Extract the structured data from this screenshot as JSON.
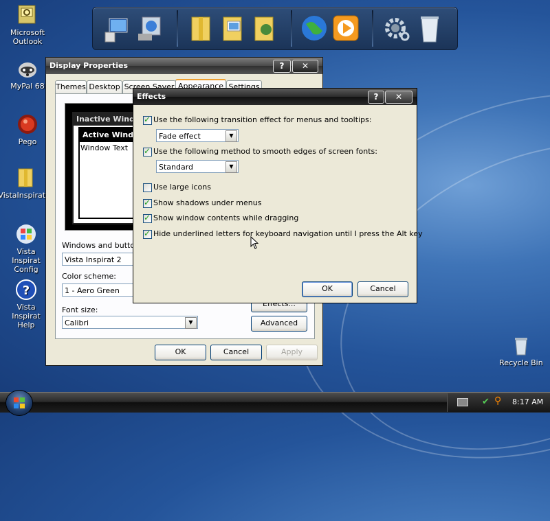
{
  "desktop": {
    "icons": [
      {
        "label": "Microsoft Outlook",
        "icon": "outlook-icon"
      },
      {
        "label": "MyPal 68",
        "icon": "raccoon-icon"
      },
      {
        "label": "Pego",
        "icon": "pego-icon"
      },
      {
        "label": "VistaInspirat...",
        "icon": "folder-icon"
      },
      {
        "label": "Vista Inspirat Config",
        "icon": "windows-logo-icon"
      },
      {
        "label": "Vista Inspirat Help",
        "icon": "help-icon"
      }
    ],
    "recycle_bin": "Recycle Bin"
  },
  "dock": {
    "items": [
      "computer-icon",
      "network-icon",
      "documents-folder-icon",
      "pictures-folder-icon",
      "music-folder-icon",
      "internet-globe-icon",
      "media-player-icon",
      "settings-gear-icon",
      "trash-icon"
    ]
  },
  "display_properties": {
    "title": "Display Properties",
    "help_btn": "?",
    "close_btn": "✕",
    "tabs": [
      "Themes",
      "Desktop",
      "Screen Saver",
      "Appearance",
      "Settings"
    ],
    "active_tab": "Appearance",
    "preview": {
      "inactive_title": "Inactive Window",
      "active_title": "Active Window",
      "window_text": "Window Text"
    },
    "windows_buttons_label": "Windows and buttons:",
    "windows_buttons_value": "Vista Inspirat 2",
    "color_scheme_label": "Color scheme:",
    "color_scheme_value": "1 - Aero Green",
    "font_size_label": "Font size:",
    "font_size_value": "Calibri",
    "effects_btn": "Effects...",
    "advanced_btn": "Advanced",
    "ok_btn": "OK",
    "cancel_btn": "Cancel",
    "apply_btn": "Apply"
  },
  "effects": {
    "title": "Effects",
    "help_btn": "?",
    "close_btn": "✕",
    "opt1": {
      "label": "Use the following transition effect for menus and tooltips:",
      "checked": true
    },
    "transition_value": "Fade effect",
    "opt2": {
      "label": "Use the following method to smooth edges of screen fonts:",
      "checked": true
    },
    "smooth_value": "Standard",
    "opt3": {
      "label": "Use large icons",
      "checked": false
    },
    "opt4": {
      "label": "Show shadows under menus",
      "checked": true
    },
    "opt5": {
      "label": "Show window contents while dragging",
      "checked": true
    },
    "opt6": {
      "label": "Hide underlined letters for keyboard navigation until I press the Alt key",
      "checked": true
    },
    "ok_btn": "OK",
    "cancel_btn": "Cancel"
  },
  "taskbar": {
    "clock": "8:17 AM"
  },
  "colors": {
    "desktop_blue": "#24549a",
    "window_face": "#ece9d8",
    "titlebar_dark": "#1e1e1e",
    "check_green": "#21a121"
  }
}
